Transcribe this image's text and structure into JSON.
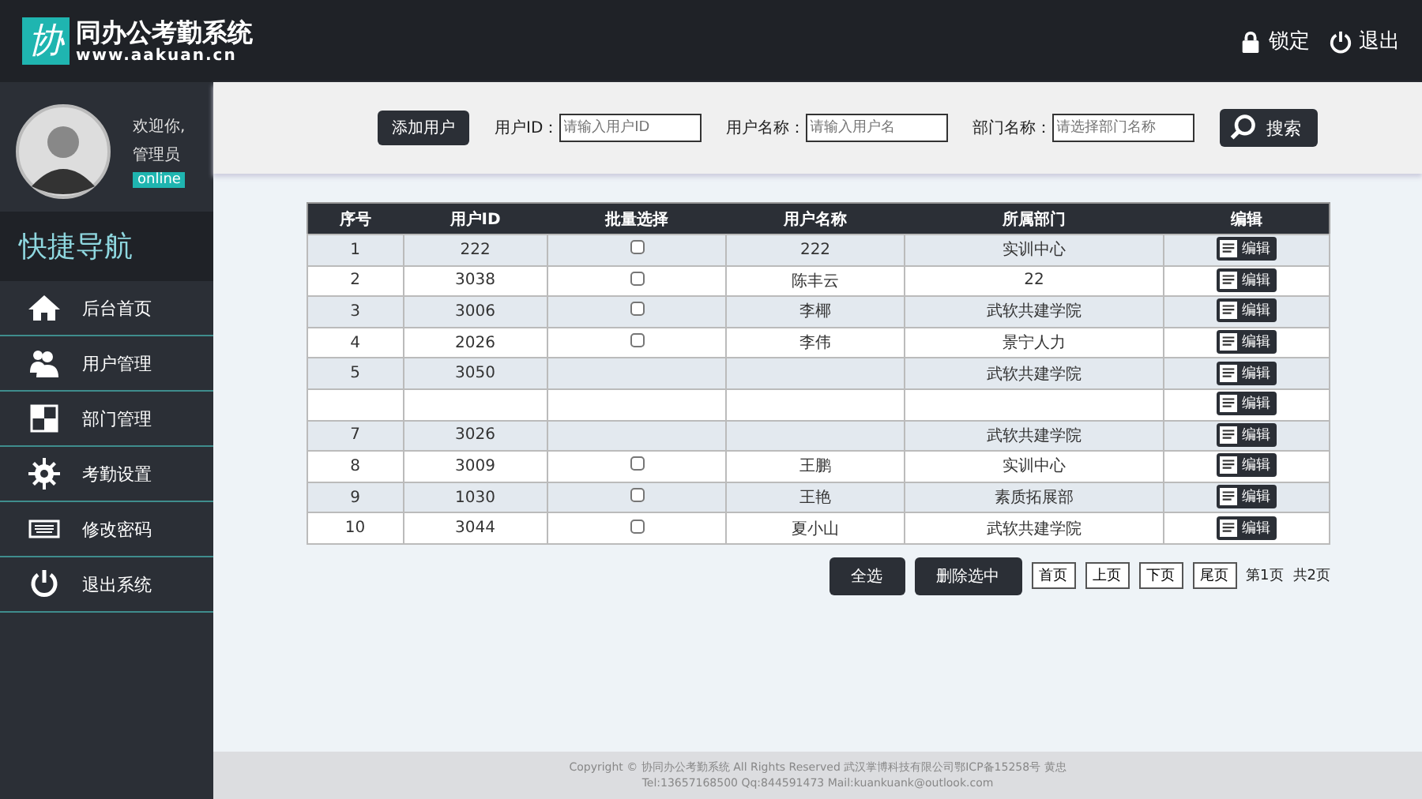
{
  "header": {
    "logo_mark": "协",
    "title": "同办公考勤系统",
    "subtitle": "www.aakuan.cn",
    "actions": [
      {
        "kind": "lock",
        "label": "锁定"
      },
      {
        "kind": "power",
        "label": "退出"
      }
    ]
  },
  "user": {
    "greeting": "欢迎你,",
    "role": "管理员",
    "status": "online"
  },
  "sidebar": {
    "title": "快捷导航",
    "items": [
      {
        "kind": "home",
        "label": "后台首页"
      },
      {
        "kind": "users",
        "label": "用户管理"
      },
      {
        "kind": "squares",
        "label": "部门管理"
      },
      {
        "kind": "gear",
        "label": "考勤设置"
      },
      {
        "kind": "keyboard",
        "label": "修改密码"
      },
      {
        "kind": "power",
        "label": "退出系统"
      }
    ]
  },
  "toolbar": {
    "add_button": "添加用户",
    "fields": [
      {
        "label": "用户ID：",
        "placeholder": "请输入用户ID"
      },
      {
        "label": "用户名称：",
        "placeholder": "请输入用户名"
      },
      {
        "label": "部门名称：",
        "placeholder": "请选择部门名称"
      }
    ],
    "search_button": "搜索"
  },
  "table": {
    "columns": [
      "序号",
      "用户ID",
      "批量选择",
      "用户名称",
      "所属部门",
      "编辑"
    ],
    "rows": [
      {
        "no": "1",
        "id": "222",
        "checked": false,
        "name": "222",
        "dept": "实训中心",
        "edit": "编辑"
      },
      {
        "no": "2",
        "id": "3038",
        "checked": false,
        "name": "陈丰云",
        "dept": "22",
        "edit": "编辑"
      },
      {
        "no": "3",
        "id": "3006",
        "checked": false,
        "name": "李椰",
        "dept": "武软共建学院",
        "edit": "编辑"
      },
      {
        "no": "4",
        "id": "2026",
        "checked": false,
        "name": "李伟",
        "dept": "景宁人力",
        "edit": "编辑"
      },
      {
        "no": "5",
        "id": "3050",
        "dept": "武软共建学院",
        "edit": "编辑"
      },
      {
        "edit": "编辑"
      },
      {
        "no": "7",
        "id": "3026",
        "dept": "武软共建学院",
        "edit": "编辑"
      },
      {
        "no": "8",
        "id": "3009",
        "checked": false,
        "name": "王鹏",
        "dept": "实训中心",
        "edit": "编辑"
      },
      {
        "no": "9",
        "id": "1030",
        "checked": false,
        "name": "王艳",
        "dept": "素质拓展部",
        "edit": "编辑"
      },
      {
        "no": "10",
        "id": "3044",
        "checked": false,
        "name": "夏小山",
        "dept": "武软共建学院",
        "edit": "编辑"
      }
    ]
  },
  "actions": [
    "全选",
    "删除选中"
  ],
  "pagination": {
    "buttons": [
      "首页",
      "上页",
      "下页",
      "尾页"
    ],
    "current": "第1页",
    "total": "共2页"
  },
  "footer": [
    "Copyright © 协同办公考勤系统 All Rights Reserved 武汉掌博科技有限公司鄂ICP备15258号 黄忠",
    "Tel:13657168500   Qq:844591473   Mail:kuankuank@outlook.com"
  ]
}
